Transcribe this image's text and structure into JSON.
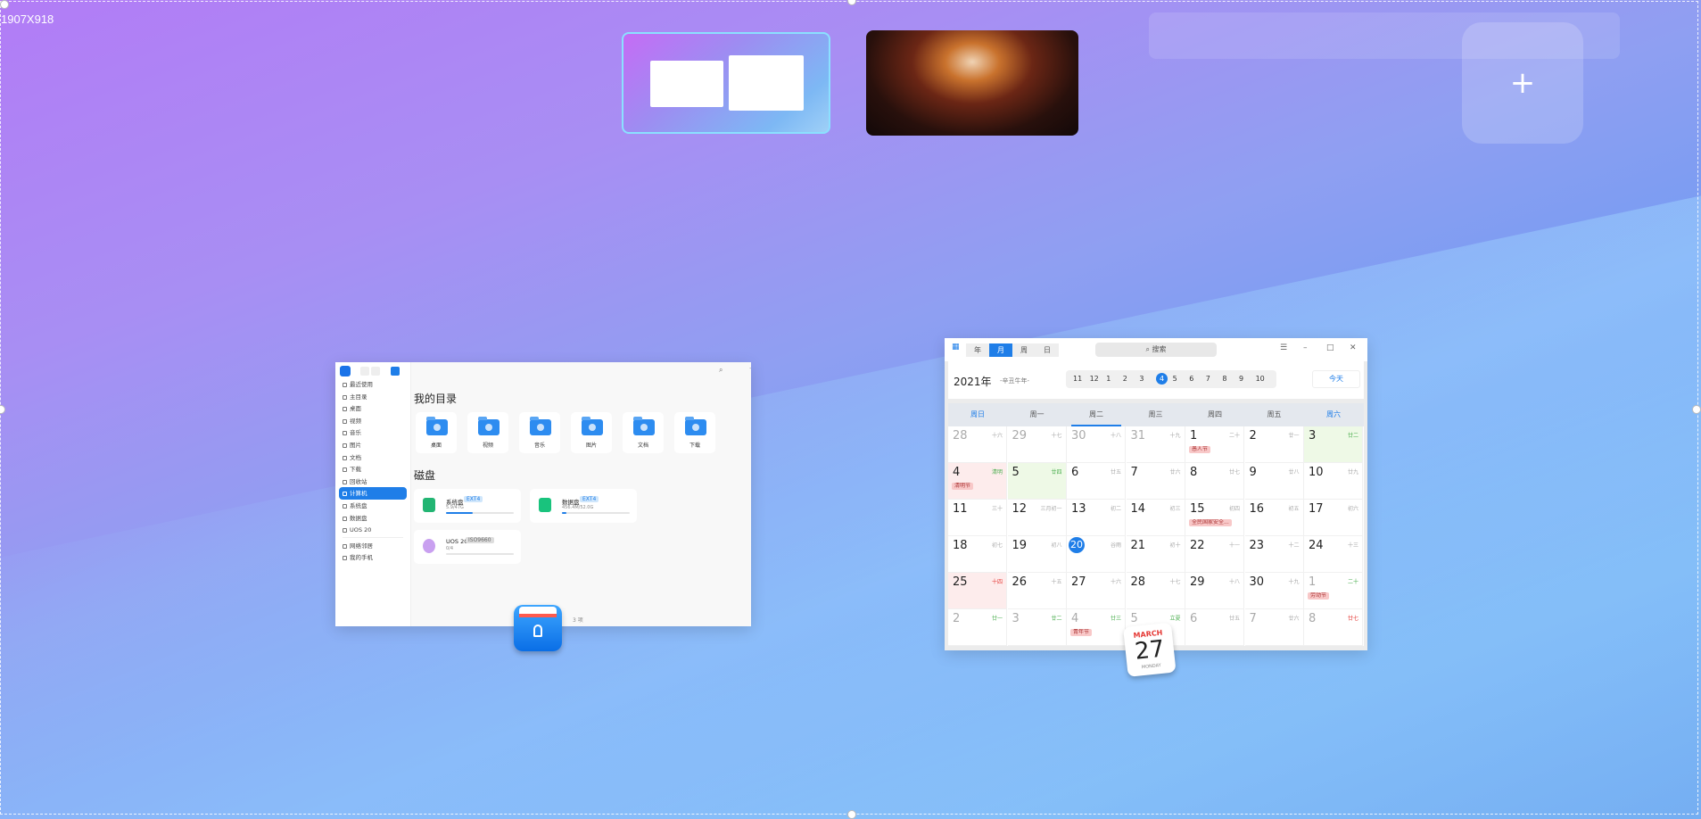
{
  "dimension_label": "1907X918",
  "workspaces": {
    "add_label": "+"
  },
  "file_manager": {
    "sidebar": [
      {
        "label": "最近使用"
      },
      {
        "label": "主目录"
      },
      {
        "label": "桌面"
      },
      {
        "label": "视频"
      },
      {
        "label": "音乐"
      },
      {
        "label": "图片"
      },
      {
        "label": "文档"
      },
      {
        "label": "下载"
      },
      {
        "label": "回收站"
      },
      {
        "label": "计算机",
        "active": true
      },
      {
        "label": "系统盘"
      },
      {
        "label": "数据盘"
      },
      {
        "label": "UOS 20"
      },
      {
        "label": "网络邻居"
      },
      {
        "label": "我的手机"
      }
    ],
    "my_dirs_title": "我的目录",
    "folders": [
      "桌面",
      "视频",
      "音乐",
      "图片",
      "文档",
      "下载"
    ],
    "disks_title": "磁盘",
    "disks": [
      {
        "name": "系统盘",
        "tag": "EXT4",
        "size": "5.9/47G",
        "fill_pct": 40,
        "icon_color": "#22b573"
      },
      {
        "name": "数据盘",
        "tag": "EXT4",
        "size": "456.4M/52.0G",
        "fill_pct": 6,
        "icon_color": "#19c37d"
      },
      {
        "name": "UOS 20",
        "tag": "ISO9660",
        "size": "0/4",
        "fill_pct": 0,
        "icon_color": "#c9a0f0"
      }
    ],
    "status": "3 项"
  },
  "calendar": {
    "tabs": [
      "年",
      "月",
      "周",
      "日"
    ],
    "active_tab": "月",
    "search_placeholder": "搜索",
    "year": "2021年",
    "lunar_year": "-辛丑牛年-",
    "months": [
      "11",
      "12",
      "1",
      "2",
      "3",
      "4",
      "5",
      "6",
      "7",
      "8",
      "9",
      "10"
    ],
    "active_month": "4",
    "today_label": "今天",
    "weekdays": [
      "周日",
      "周一",
      "周二",
      "周三",
      "周四",
      "周五",
      "周六"
    ],
    "days": [
      {
        "d": "28",
        "l": "十六",
        "o": true
      },
      {
        "d": "29",
        "l": "十七",
        "o": true
      },
      {
        "d": "30",
        "l": "十八",
        "o": true
      },
      {
        "d": "31",
        "l": "十九",
        "o": true
      },
      {
        "d": "1",
        "l": "二十",
        "ev": "愚人节"
      },
      {
        "d": "2",
        "l": "廿一"
      },
      {
        "d": "3",
        "l": "廿二",
        "h": "holi",
        "bg": "green"
      },
      {
        "d": "4",
        "l": "清明",
        "h": "holi",
        "ev": "清明节",
        "bg": "pink"
      },
      {
        "d": "5",
        "l": "廿四",
        "h": "holi",
        "bg": "green"
      },
      {
        "d": "6",
        "l": "廿五"
      },
      {
        "d": "7",
        "l": "廿六"
      },
      {
        "d": "8",
        "l": "廿七"
      },
      {
        "d": "9",
        "l": "廿八"
      },
      {
        "d": "10",
        "l": "廿九"
      },
      {
        "d": "11",
        "l": "三十"
      },
      {
        "d": "12",
        "l": "三月初一"
      },
      {
        "d": "13",
        "l": "初二"
      },
      {
        "d": "14",
        "l": "初三"
      },
      {
        "d": "15",
        "l": "初四",
        "ev": "全民国家安全..."
      },
      {
        "d": "16",
        "l": "初五"
      },
      {
        "d": "17",
        "l": "初六"
      },
      {
        "d": "18",
        "l": "初七"
      },
      {
        "d": "19",
        "l": "初八"
      },
      {
        "d": "20",
        "l": "谷雨",
        "today": true
      },
      {
        "d": "21",
        "l": "初十"
      },
      {
        "d": "22",
        "l": "十一"
      },
      {
        "d": "23",
        "l": "十二"
      },
      {
        "d": "24",
        "l": "十三"
      },
      {
        "d": "25",
        "l": "十四",
        "h": "red",
        "bg": "pink"
      },
      {
        "d": "26",
        "l": "十五"
      },
      {
        "d": "27",
        "l": "十六"
      },
      {
        "d": "28",
        "l": "十七"
      },
      {
        "d": "29",
        "l": "十八"
      },
      {
        "d": "30",
        "l": "十九"
      },
      {
        "d": "1",
        "l": "二十",
        "h": "holi",
        "ev": "劳动节",
        "o": true
      },
      {
        "d": "2",
        "l": "廿一",
        "h": "holi",
        "o": true
      },
      {
        "d": "3",
        "l": "廿二",
        "h": "holi",
        "o": true
      },
      {
        "d": "4",
        "l": "廿三",
        "h": "holi",
        "ev": "青年节",
        "o": true
      },
      {
        "d": "5",
        "l": "立夏",
        "h": "holi",
        "o": true
      },
      {
        "d": "6",
        "l": "廿五",
        "o": true
      },
      {
        "d": "7",
        "l": "廿六",
        "o": true
      },
      {
        "d": "8",
        "l": "廿七",
        "h": "red",
        "o": true
      }
    ]
  },
  "calendar_icon": {
    "month": "MARCH",
    "day": "27",
    "weekday": "MONDAY"
  }
}
